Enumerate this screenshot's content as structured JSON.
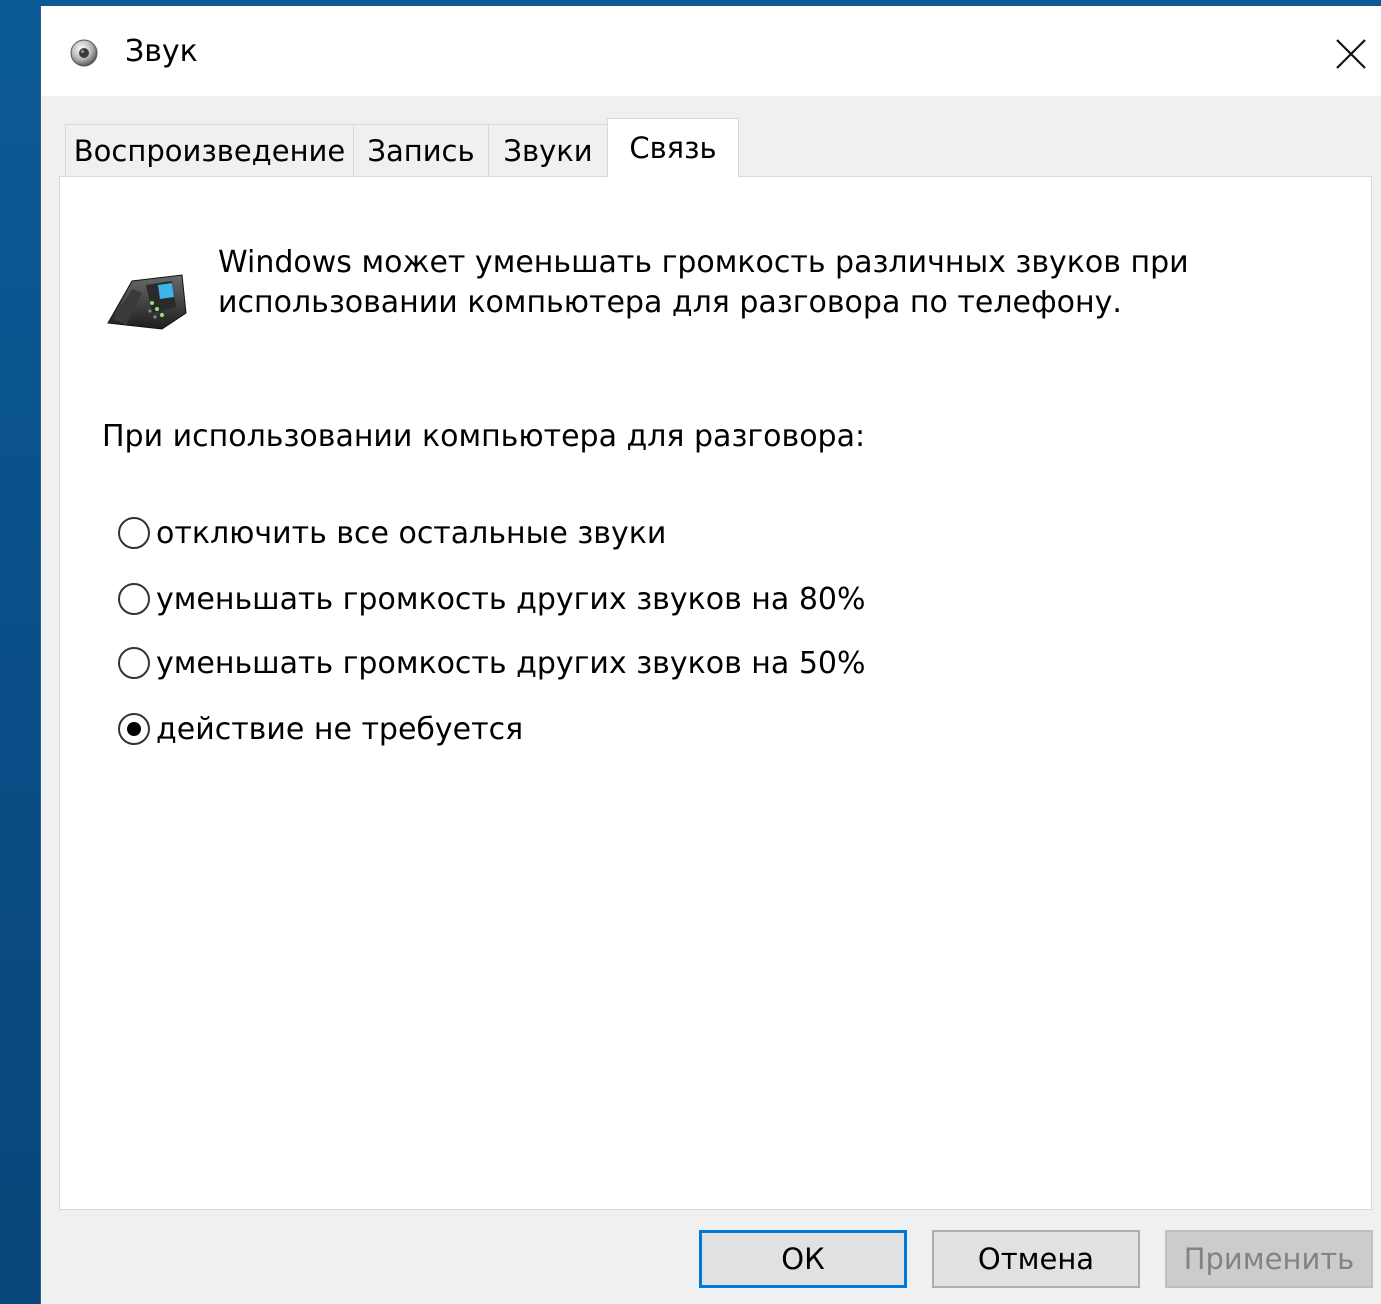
{
  "window": {
    "title": "Звук",
    "close_symbol": "✕"
  },
  "tabs": [
    {
      "label": "Воспроизведение",
      "active": false
    },
    {
      "label": "Запись",
      "active": false
    },
    {
      "label": "Звуки",
      "active": false
    },
    {
      "label": "Связь",
      "active": true
    }
  ],
  "communications": {
    "intro_line1": "Windows может уменьшать громкость различных звуков при",
    "intro_line2": "использовании компьютера для разговора по телефону.",
    "section_label": "При использовании компьютера для разговора:",
    "options": [
      {
        "label": "отключить все остальные звуки",
        "checked": false
      },
      {
        "label": "уменьшать громкость других звуков на 80%",
        "checked": false
      },
      {
        "label": "уменьшать громкость других звуков на 50%",
        "checked": false
      },
      {
        "label": "действие не требуется",
        "checked": true
      }
    ]
  },
  "buttons": {
    "ok": "ОК",
    "cancel": "Отмена",
    "apply": "Применить"
  },
  "icons": {
    "title": "speaker-icon",
    "phone": "telephone-icon"
  },
  "colors": {
    "accent": "#0078d7",
    "desktop": "#0a4a80"
  }
}
